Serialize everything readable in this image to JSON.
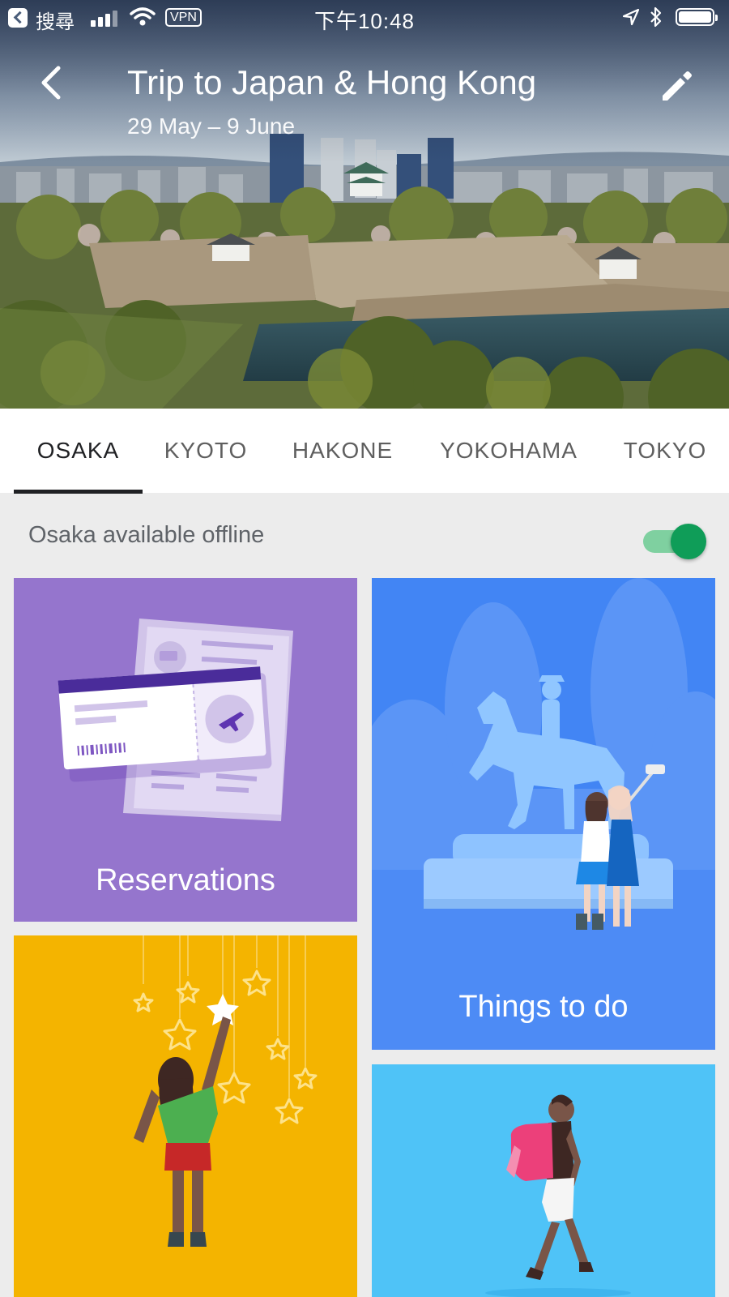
{
  "status_bar": {
    "carrier": "搜尋",
    "vpn": "VPN",
    "time": "下午10:48"
  },
  "header": {
    "title": "Trip to Japan & Hong Kong",
    "dates": "29 May – 9 June"
  },
  "tabs": [
    {
      "label": "OSAKA",
      "active": true
    },
    {
      "label": "KYOTO",
      "active": false
    },
    {
      "label": "HAKONE",
      "active": false
    },
    {
      "label": "YOKOHAMA",
      "active": false
    },
    {
      "label": "TOKYO",
      "active": false
    }
  ],
  "offline": {
    "label": "Osaka available offline",
    "enabled": true
  },
  "cards": {
    "reservations": "Reservations",
    "things_to_do": "Things to do"
  },
  "colors": {
    "reservations": "#9575cd",
    "things_to_do": "#4285f4",
    "saved_places": "#f4b400",
    "getting_around": "#4fc3f7",
    "toggle_on": "#0f9d58"
  }
}
